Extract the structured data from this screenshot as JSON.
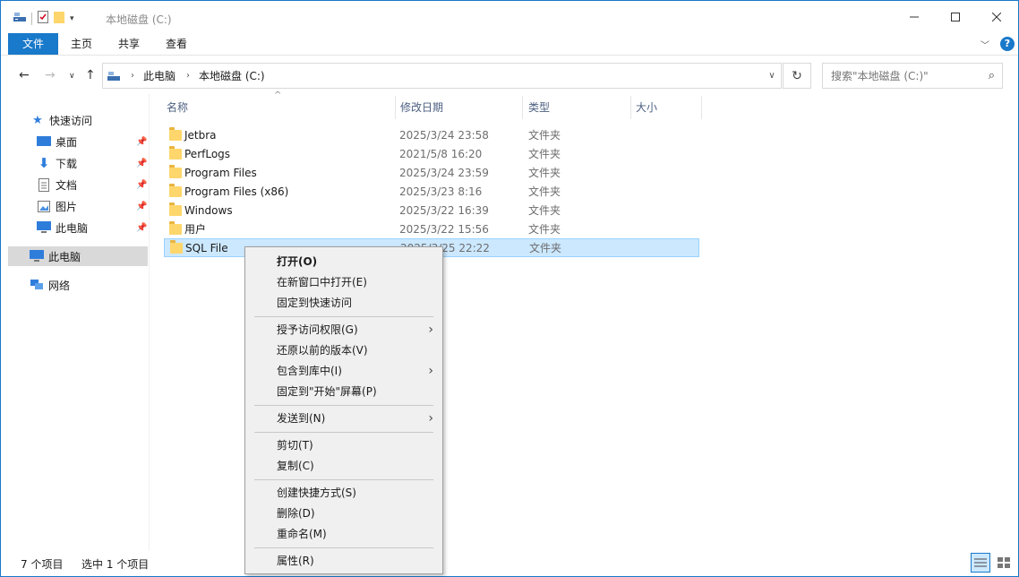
{
  "window": {
    "title": "本地磁盘 (C:)"
  },
  "ribbon": {
    "tabs": [
      {
        "label": "文件"
      },
      {
        "label": "主页"
      },
      {
        "label": "共享"
      },
      {
        "label": "查看"
      }
    ]
  },
  "address": {
    "crumbs": [
      "此电脑",
      "本地磁盘 (C:)"
    ]
  },
  "search": {
    "placeholder": "搜索\"本地磁盘 (C:)\""
  },
  "sidebar": {
    "quick_access": "快速访问",
    "items": [
      {
        "label": "桌面",
        "icon": "desktop-icon",
        "pinned": true
      },
      {
        "label": "下载",
        "icon": "download-icon",
        "pinned": true
      },
      {
        "label": "文档",
        "icon": "document-icon",
        "pinned": true
      },
      {
        "label": "图片",
        "icon": "picture-icon",
        "pinned": true
      },
      {
        "label": "此电脑",
        "icon": "computer-icon",
        "pinned": true
      }
    ],
    "this_pc": "此电脑",
    "network": "网络"
  },
  "columns": {
    "name": "名称",
    "date": "修改日期",
    "type": "类型",
    "size": "大小"
  },
  "files": [
    {
      "name": "Jetbra",
      "date": "2025/3/24 23:58",
      "type": "文件夹"
    },
    {
      "name": "PerfLogs",
      "date": "2021/5/8 16:20",
      "type": "文件夹"
    },
    {
      "name": "Program Files",
      "date": "2025/3/24 23:59",
      "type": "文件夹"
    },
    {
      "name": "Program Files (x86)",
      "date": "2025/3/23 8:16",
      "type": "文件夹"
    },
    {
      "name": "Windows",
      "date": "2025/3/22 16:39",
      "type": "文件夹"
    },
    {
      "name": "用户",
      "date": "2025/3/22 15:56",
      "type": "文件夹"
    },
    {
      "name": "SQL File",
      "date": "2025/3/25 22:22",
      "type": "文件夹",
      "selected": true
    }
  ],
  "status": {
    "count": "7 个项目",
    "selected": "选中 1 个项目"
  },
  "context_menu": {
    "items": [
      {
        "label": "打开(O)"
      },
      {
        "label": "在新窗口中打开(E)"
      },
      {
        "label": "固定到快速访问"
      },
      {
        "label": "授予访问权限(G)"
      },
      {
        "label": "还原以前的版本(V)"
      },
      {
        "label": "包含到库中(I)"
      },
      {
        "label": "固定到\"开始\"屏幕(P)"
      },
      {
        "label": "发送到(N)"
      },
      {
        "label": "剪切(T)"
      },
      {
        "label": "复制(C)"
      },
      {
        "label": "创建快捷方式(S)"
      },
      {
        "label": "删除(D)"
      },
      {
        "label": "重命名(M)"
      },
      {
        "label": "属性(R)"
      }
    ]
  },
  "colors": {
    "accent": "#1979ca",
    "selection": "#cce8ff",
    "folder": "#ffd66b"
  }
}
